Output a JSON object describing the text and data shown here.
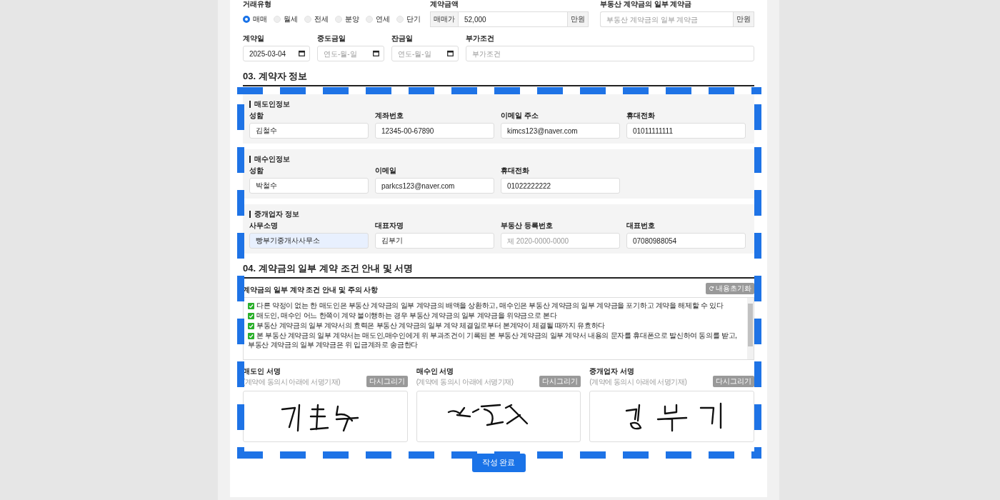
{
  "deal": {
    "type_label": "거래유형",
    "types": [
      {
        "label": "매매",
        "selected": true
      },
      {
        "label": "월세",
        "selected": false
      },
      {
        "label": "전세",
        "selected": false
      },
      {
        "label": "분양",
        "selected": false
      },
      {
        "label": "연세",
        "selected": false
      },
      {
        "label": "단기",
        "selected": false
      }
    ],
    "amount": {
      "label": "계약금액",
      "prefix": "매매가",
      "value": "52,000",
      "unit": "만원"
    },
    "partial": {
      "label": "부동산 계약금의 일부 계약금",
      "placeholder": "부동산 계약금의 일부 계약금",
      "unit": "만원"
    }
  },
  "dates": [
    {
      "kind": "date",
      "label": "계약일",
      "value": "2025-03-04"
    },
    {
      "kind": "date",
      "label": "중도금일",
      "placeholder": "연도-월-일"
    },
    {
      "kind": "date",
      "label": "잔금일",
      "placeholder": "연도-월-일"
    },
    {
      "kind": "text",
      "label": "부가조건",
      "placeholder": "부가조건"
    }
  ],
  "section3": {
    "title": "03. 계약자 정보",
    "groups": [
      {
        "title": "매도인정보",
        "fields": [
          {
            "label": "성함",
            "value": "김철수",
            "autofilled": false
          },
          {
            "label": "계좌번호",
            "value": "12345-00-67890",
            "autofilled": false
          },
          {
            "label": "이메일 주소",
            "value": "kimcs123@naver.com",
            "autofilled": false
          },
          {
            "label": "휴대전화",
            "value": "01011111111",
            "autofilled": false
          }
        ]
      },
      {
        "title": "매수인정보",
        "fields": [
          {
            "label": "성함",
            "value": "박철수",
            "autofilled": false
          },
          {
            "label": "이메일",
            "value": "parkcs123@naver.com",
            "autofilled": false
          },
          {
            "label": "휴대전화",
            "value": "01022222222",
            "autofilled": false
          }
        ]
      },
      {
        "title": "중개업자 정보",
        "fields": [
          {
            "label": "사무소명",
            "value": "빵부기중개사사무소",
            "autofilled": true
          },
          {
            "label": "대표자명",
            "value": "김부기",
            "autofilled": false
          },
          {
            "label": "부동산 등록번호",
            "placeholder": "제 2020-0000-0000",
            "autofilled": false
          },
          {
            "label": "대표번호",
            "value": "07080988054",
            "autofilled": false
          }
        ]
      }
    ]
  },
  "section4": {
    "title": "04. 계약금의 일부 계약 조건 안내 및 서명",
    "notice_title": "계약금의 일부 계약 조건 안내 및 주의 사항",
    "reset_button": "내용초기화",
    "notices": [
      "다른 약정이 없는 한 매도인은 부동산 계약금의 일부 계약금의 배액을 상환하고, 매수인은 부동산 계약금의 일부 계약금을 포기하고 계약을 해제할 수 있다",
      "매도인, 매수인 어느 한쪽이 계약 불이행하는 경우 부동산 계약금의 일부 계약금을 위약금으로 본다",
      "부동산 계약금의 일부 계약서의 효력은 부동산 계약금의 일부 계약 체결일로부터 본계약이 체결될 때까지 유효하다",
      "본 부동산 계약금의 일부 계약서는 매도인,매수인에게 위 부과조건이 기록된 본 부동산 계약금의 일부 계약서 내용의 문자를 휴대폰으로 발신하여 동의를 받고, 부동산 계약금의 일부 계약금은 위 입금계좌로 송금한다"
    ],
    "signatures": [
      {
        "title": "매도인 서명",
        "hint": "(계약에 동의시 아래에 서명기재)",
        "button": "다시그리기"
      },
      {
        "title": "매수인 서명",
        "hint": "(계약에 동의시 아래에 서명기재)",
        "button": "다시그리기"
      },
      {
        "title": "중개업자 서명",
        "hint": "(계약에 동의시 아래에 서명기재)",
        "button": "다시그리기"
      }
    ],
    "submit": "작성 완료"
  }
}
